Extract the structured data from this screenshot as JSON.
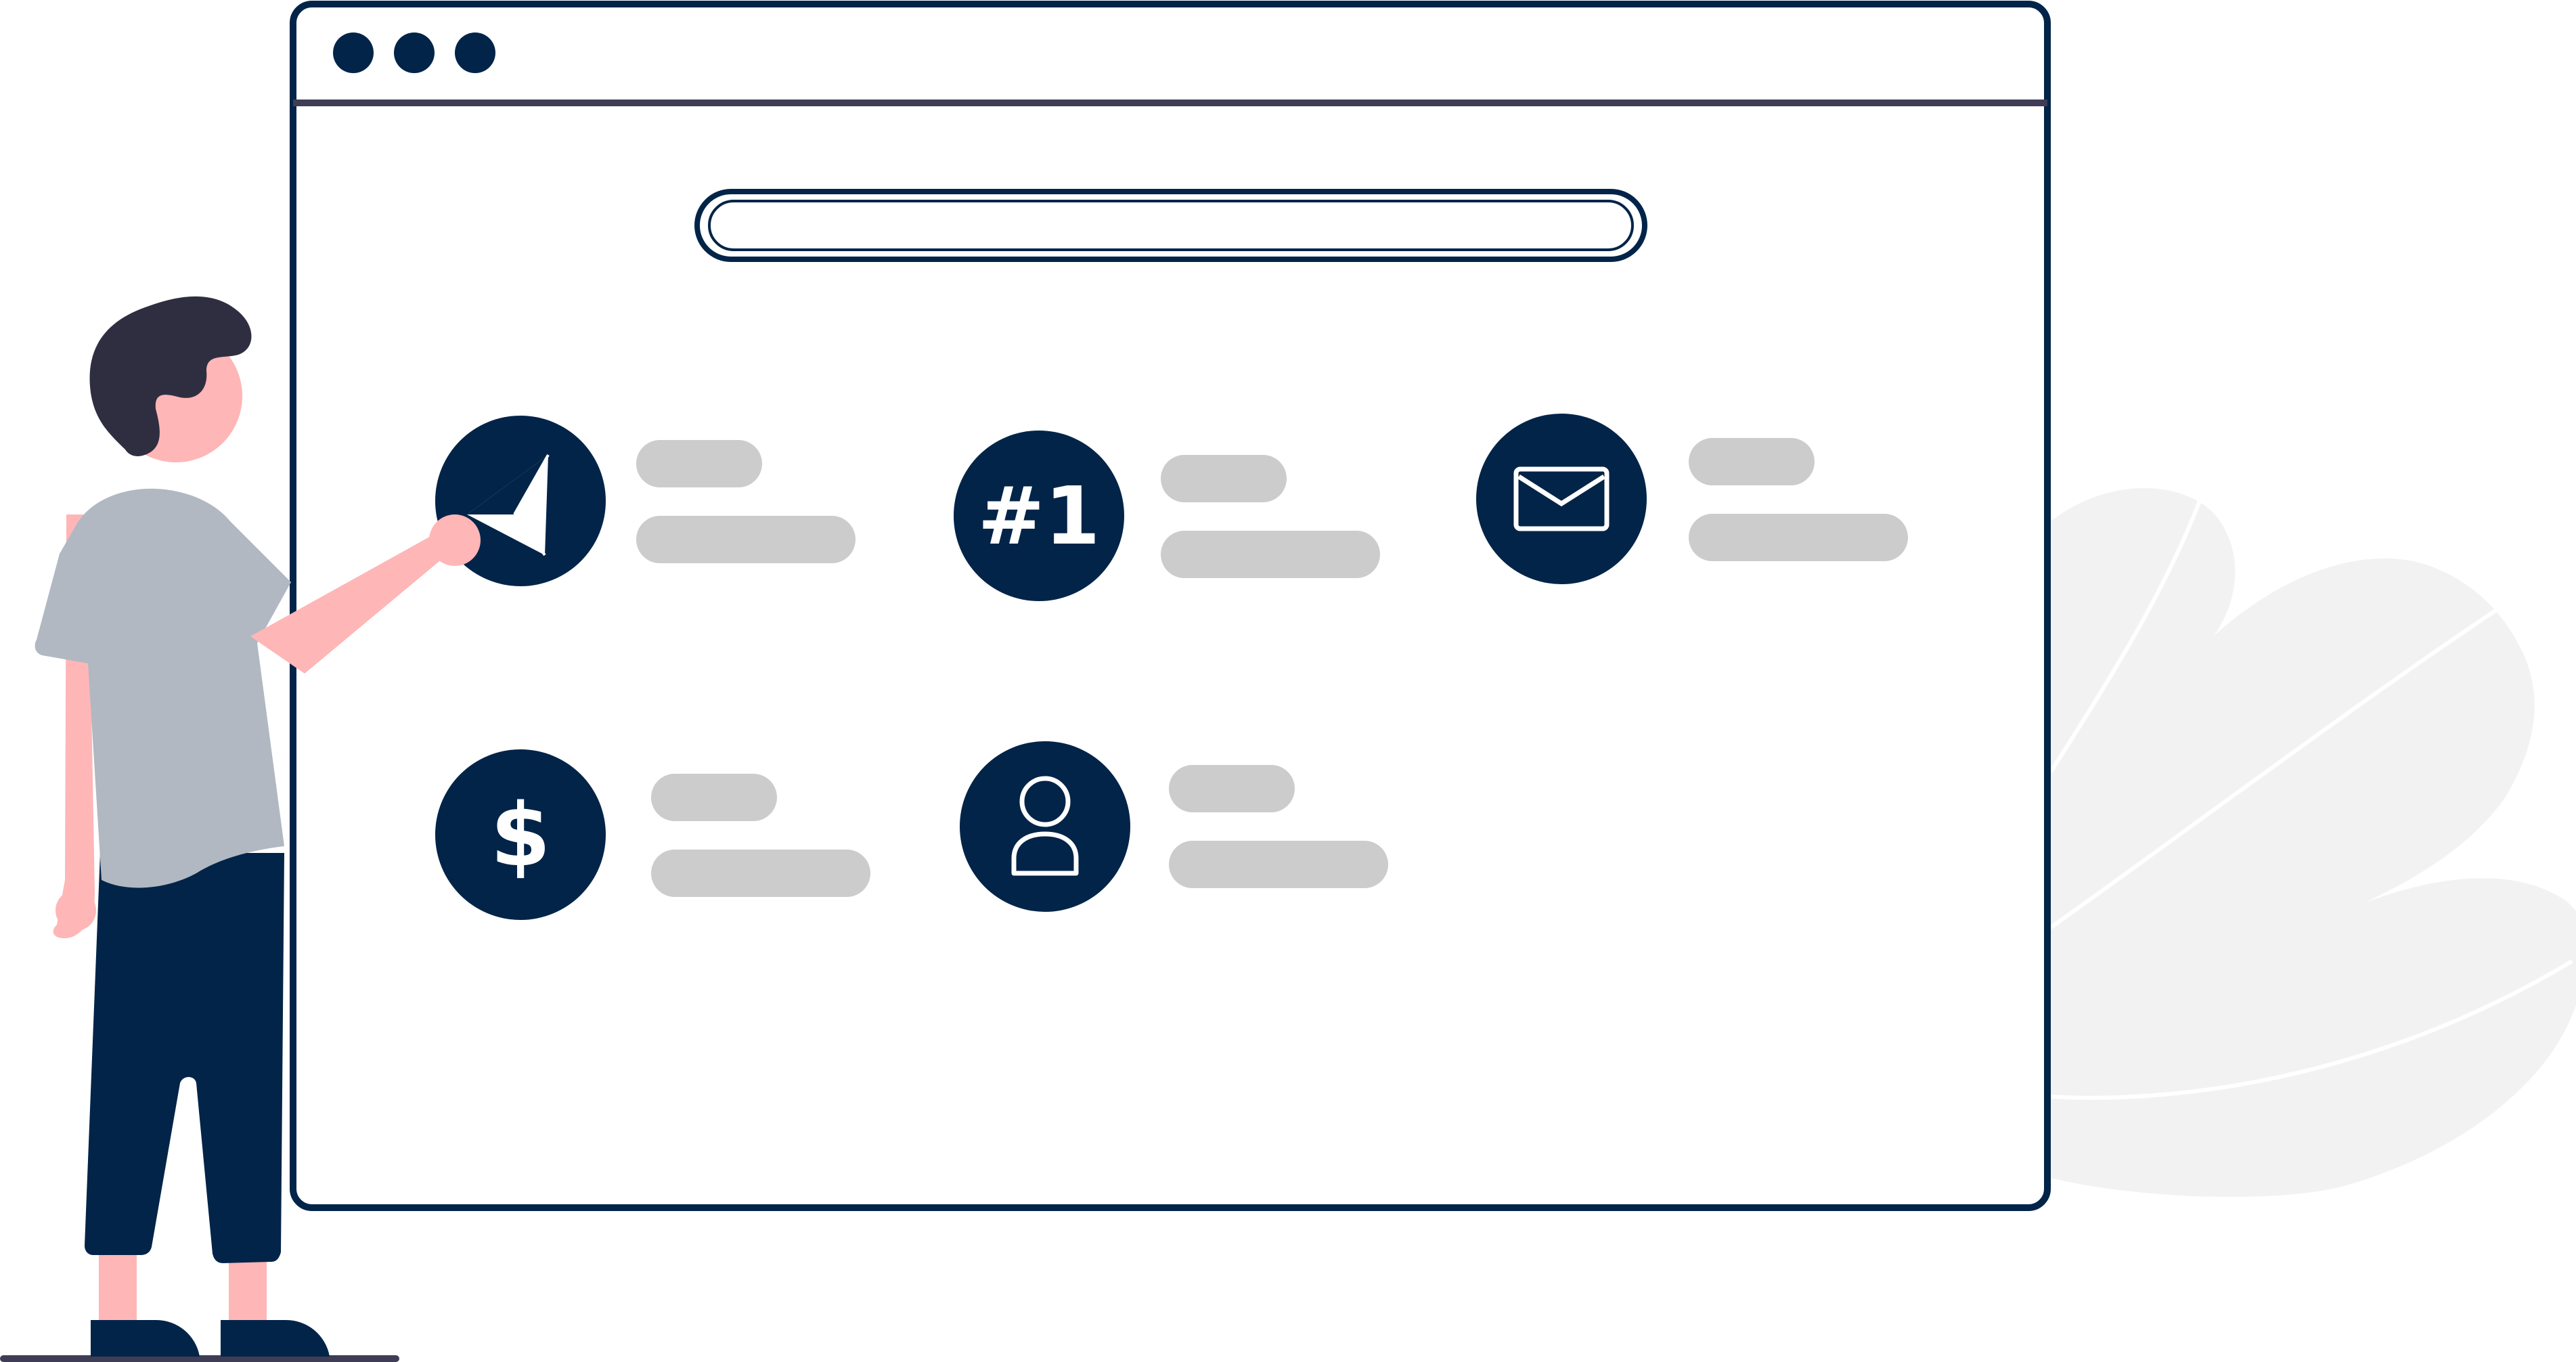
{
  "colors": {
    "navy": "#022448",
    "frame_stroke": "#022448",
    "divider": "#3F3D56",
    "skeleton_gray": "#CCCCCC",
    "plant_gray": "#F2F2F2",
    "skin": "#FFB6B6",
    "hair": "#2F2E41",
    "shirt": "#B1B8C2",
    "floor": "#3F3D56",
    "white": "#FFFFFF"
  },
  "window": {
    "traffic_lights": [
      "window-dot",
      "window-dot",
      "window-dot"
    ],
    "search_bar": {
      "placeholder": ""
    }
  },
  "features": [
    {
      "icon": "paper-plane-icon",
      "glyph": ""
    },
    {
      "icon": "rank-number-one-icon",
      "glyph": "#1"
    },
    {
      "icon": "envelope-icon",
      "glyph": ""
    },
    {
      "icon": "dollar-icon",
      "glyph": "$"
    },
    {
      "icon": "user-icon",
      "glyph": ""
    }
  ],
  "illustration": {
    "person": "person-pointing",
    "plant": "decorative-leaves"
  }
}
